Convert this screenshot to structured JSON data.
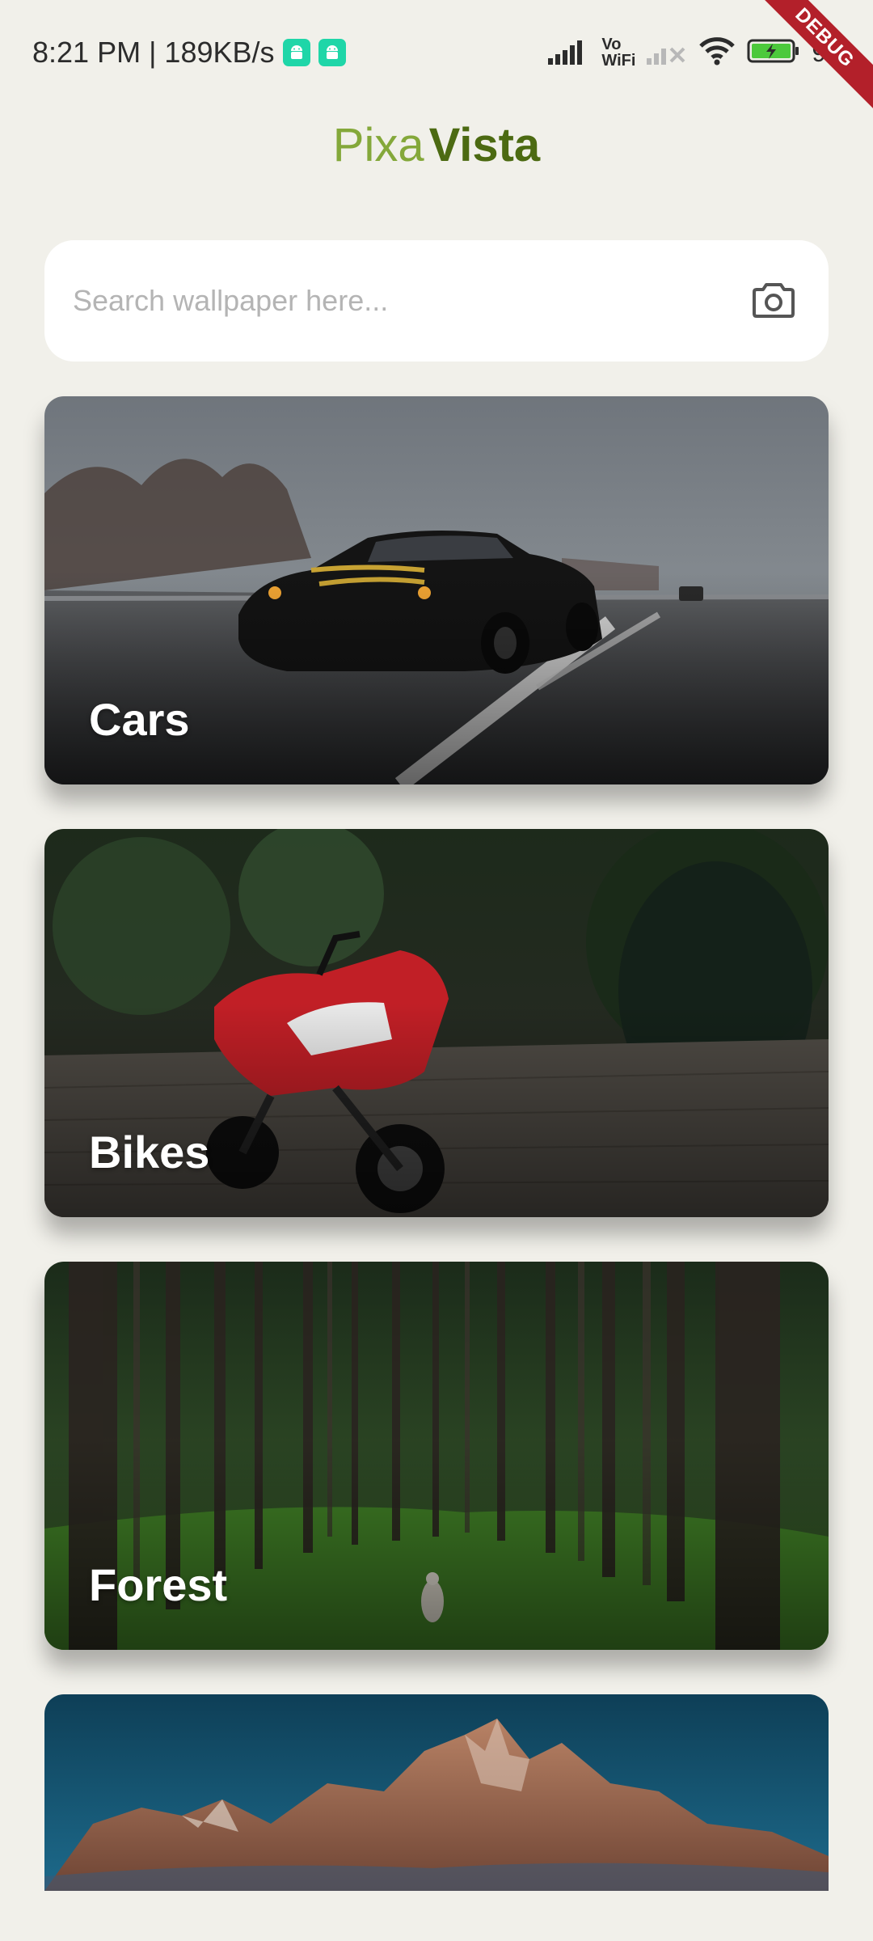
{
  "status_bar": {
    "time_speed": "8:21 PM | 189KB/s",
    "vowifi_top": "Vo",
    "vowifi_bottom": "WiFi",
    "battery": "95"
  },
  "debug_banner": "DEBUG",
  "app_title": {
    "part1": "Pixa",
    "part2": "Vista"
  },
  "search": {
    "placeholder": "Search wallpaper here..."
  },
  "categories": [
    {
      "label": "Cars"
    },
    {
      "label": "Bikes"
    },
    {
      "label": "Forest"
    },
    {
      "label": ""
    }
  ],
  "colors": {
    "background": "#f1f0ea",
    "title_light": "#84a83a",
    "title_dark": "#4c6a12",
    "debug_ribbon": "#b3202a"
  }
}
